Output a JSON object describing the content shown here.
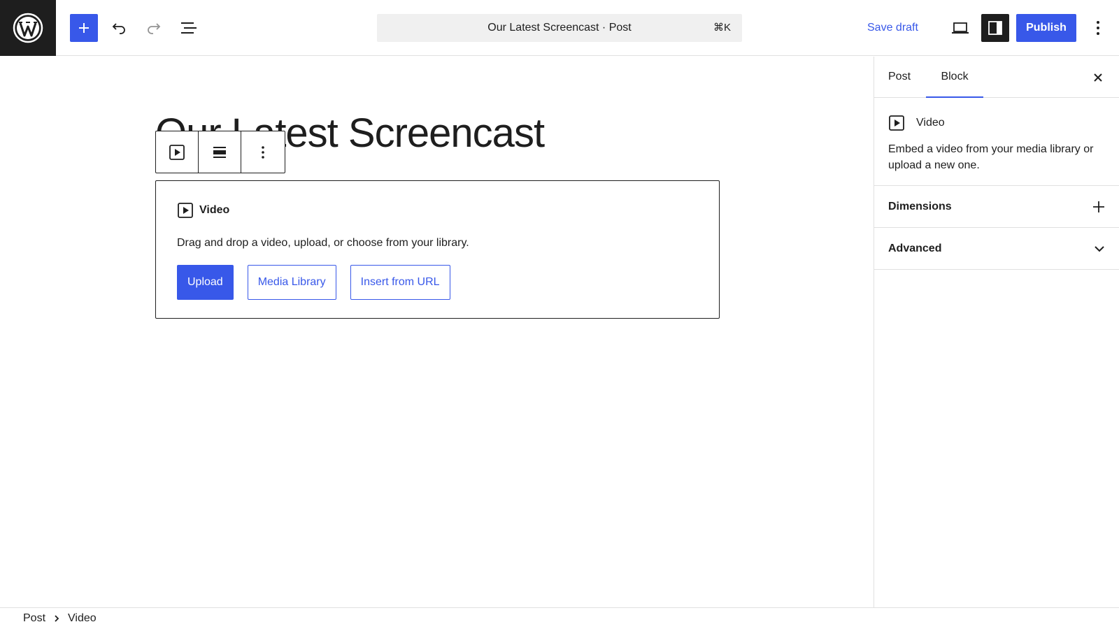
{
  "header": {
    "command": {
      "title": "Our Latest Screencast · Post",
      "shortcut": "⌘K"
    },
    "save_draft": "Save draft",
    "publish": "Publish",
    "icons": [
      "wordpress-icon",
      "plus-icon",
      "undo-icon",
      "redo-icon",
      "list-view-icon",
      "desktop-preview-icon",
      "sidebar-icon",
      "more-vertical-icon"
    ]
  },
  "editor": {
    "post_title": "Our Latest Screencast",
    "placeholder": {
      "label": "Video",
      "description": "Drag and drop a video, upload, or choose from your library.",
      "buttons": {
        "upload": "Upload",
        "media_library": "Media Library",
        "insert_url": "Insert from URL"
      }
    }
  },
  "sidebar": {
    "tabs": {
      "post": "Post",
      "block": "Block"
    },
    "block_card": {
      "title": "Video",
      "description": "Embed a video from your media library or upload a new one."
    },
    "panels": {
      "dimensions": "Dimensions",
      "advanced": "Advanced"
    }
  },
  "breadcrumb": {
    "items": [
      "Post",
      "Video"
    ]
  },
  "colors": {
    "accent": "#3858e9",
    "dark": "#1e1e1e",
    "border": "#e0e0e0"
  }
}
